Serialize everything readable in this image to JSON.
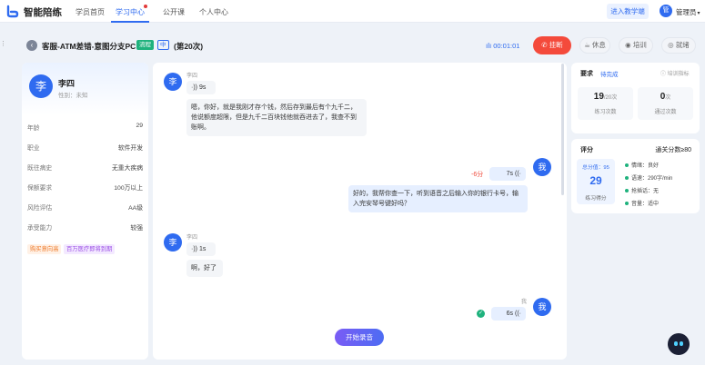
{
  "nav": {
    "brand": "智能陪练",
    "items": [
      {
        "label": "学员首页",
        "active": false
      },
      {
        "label": "学习中心",
        "active": true
      },
      {
        "label": "公开课",
        "active": false
      },
      {
        "label": "个人中心",
        "active": false
      }
    ],
    "enter_button": "进入教学端",
    "user_avatar_char": "管",
    "user_name": "管理员",
    "user_caret": "▾"
  },
  "task": {
    "back_icon": "‹",
    "title": "客服-ATM差错-意图分支PC",
    "flow_tag": "流程",
    "level_tag": "中",
    "count": "(第20次)",
    "timer_icon": "ılı",
    "timer": "00:01:01",
    "hangup_label": "挂断",
    "rest_label": "休息",
    "train_label": "培训",
    "ready_label": "就绪"
  },
  "customer": {
    "avatar_char": "李",
    "name": "李四",
    "gender": "性别：未知",
    "fields": [
      {
        "key": "年龄",
        "value": "29"
      },
      {
        "key": "职业",
        "value": "软件开发"
      },
      {
        "key": "既往病史",
        "value": "无重大疾病"
      },
      {
        "key": "保额要求",
        "value": "100万以上"
      },
      {
        "key": "风险评估",
        "value": "AA级"
      },
      {
        "key": "承受能力",
        "value": "较强"
      }
    ],
    "tags": [
      "购买意向高",
      "百万医疗即将到期"
    ]
  },
  "chat": {
    "messages": [
      {
        "side": "left",
        "sender": "李四",
        "avatar": "李",
        "voice": "·)) 9s",
        "text": "嗯，你好，就是我刚才存个钱，然后存到最后有个九千二，他说额度超限，但是九千二百块钱他就吞进去了，我查不到账啊。"
      },
      {
        "side": "right",
        "sender": "我",
        "avatar": "我",
        "voice": "7s ((·",
        "penalty": "-6分",
        "text": "好的，我帮你查一下，听到语音之后输入你的银行卡号，输入完安琴号键好吗？"
      },
      {
        "side": "left",
        "sender": "李四",
        "avatar": "李",
        "voice": "·)) 1s",
        "text": "啊，好了"
      },
      {
        "side": "right",
        "sender": "我",
        "avatar": "我",
        "voice": "6s ((·",
        "check": "✓"
      }
    ],
    "record_button": "开始录音"
  },
  "requirements": {
    "label": "要求",
    "status": "待完成",
    "link": "ⓘ 培训指标",
    "practice_count": "19",
    "practice_total": "/20次",
    "practice_label": "练习次数",
    "pass_count": "0",
    "pass_unit": "次",
    "pass_label": "通过次数"
  },
  "score": {
    "label": "评分",
    "pass_line": "通关分数≥80",
    "total_head": "总分值：95",
    "total": "29",
    "total_label": "练习得分",
    "metrics": [
      "情绪：良好",
      "语速：290字/min",
      "抢插话：无",
      "音量：适中"
    ]
  },
  "colors": {
    "accent": "#2f6bf0",
    "danger": "#f44a3b",
    "success": "#1fb27d"
  }
}
